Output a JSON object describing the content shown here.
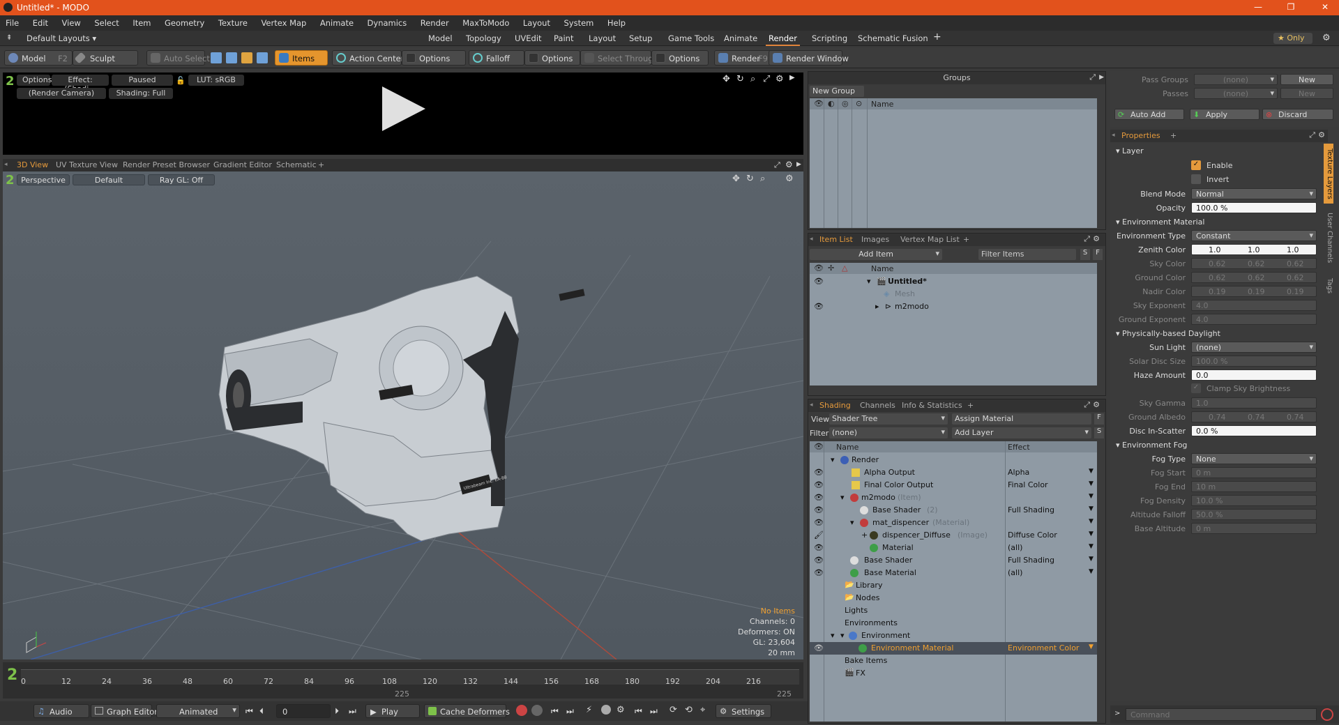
{
  "window": {
    "title": "Untitled* - MODO",
    "minimize": "—",
    "maximize": "❐",
    "close": "✕"
  },
  "menu": [
    "File",
    "Edit",
    "View",
    "Select",
    "Item",
    "Geometry",
    "Texture",
    "Vertex Map",
    "Animate",
    "Dynamics",
    "Render",
    "MaxToModo",
    "Layout",
    "System",
    "Help"
  ],
  "layouts": {
    "selector": "Default Layouts ▾",
    "tabs": [
      "Model",
      "Topology",
      "UVEdit",
      "Paint",
      "Layout",
      "Setup",
      "Game Tools",
      "Animate",
      "Render",
      "Scripting",
      "Schematic Fusion"
    ],
    "active": "Render",
    "add": "+",
    "only": "★ Only"
  },
  "toolbar": {
    "model": "Model",
    "model_key": "F2",
    "sculpt": "Sculpt",
    "auto_select": "Auto Select",
    "items": "Items",
    "action_center": "Action Center",
    "options1": "Options",
    "falloff": "Falloff",
    "options2": "Options",
    "select_through": "Select Through",
    "options3": "Options",
    "render": "Render",
    "render_key": "F9",
    "render_window": "Render Window"
  },
  "preview": {
    "options": "Options",
    "effect": "Effect: (Shadi...",
    "paused": "Paused",
    "lut": "LUT: sRGB",
    "camera": "(Render Camera)",
    "shading": "Shading: Full"
  },
  "viewtabs": {
    "tabs": [
      "3D View",
      "UV Texture View",
      "Render Preset Browser",
      "Gradient Editor",
      "Schematic"
    ],
    "add": "+"
  },
  "viewport": {
    "projection": "Perspective",
    "style": "Default",
    "raygl": "Ray GL: Off",
    "stats": [
      "No Items",
      "Channels: 0",
      "Deformers: ON",
      "GL: 23,604",
      "20 mm"
    ],
    "model_label": "Ultrabeam Inc. EA-88"
  },
  "timeline": {
    "ticks": [
      "0",
      "12",
      "24",
      "36",
      "48",
      "60",
      "72",
      "84",
      "96",
      "108",
      "120",
      "132",
      "144",
      "156",
      "168",
      "180",
      "192",
      "204",
      "216"
    ],
    "mid": "225",
    "end": "225"
  },
  "bottom": {
    "audio": "Audio",
    "graph_editor": "Graph Editor",
    "animated": "Animated",
    "frame": "0",
    "play": "Play",
    "cache": "Cache Deformers",
    "settings": "Settings"
  },
  "groups": {
    "title": "Groups",
    "new_group": "New Group",
    "col_name": "Name"
  },
  "itemlist": {
    "tabs": [
      "Item List",
      "Images",
      "Vertex Map List"
    ],
    "add": "+",
    "add_item": "Add Item",
    "filter": "Filter Items",
    "col_name": "Name",
    "rows": [
      {
        "name": "Untitled*"
      },
      {
        "name": "Mesh"
      },
      {
        "name": "m2modo"
      }
    ]
  },
  "shading": {
    "tabs": [
      "Shading",
      "Channels",
      "Info & Statistics"
    ],
    "add": "+",
    "view_label": "View",
    "view_value": "Shader Tree",
    "assign": "Assign Material",
    "filter_label": "Filter",
    "filter_value": "(none)",
    "add_layer": "Add Layer",
    "col_name": "Name",
    "col_effect": "Effect",
    "rows": [
      {
        "name": "Render",
        "sub": "",
        "effect": ""
      },
      {
        "name": "Alpha Output",
        "sub": "",
        "effect": "Alpha"
      },
      {
        "name": "Final Color Output",
        "sub": "",
        "effect": "Final Color"
      },
      {
        "name": "m2modo",
        "sub": "(Item)",
        "effect": ""
      },
      {
        "name": "Base Shader",
        "sub": "(2)",
        "effect": "Full Shading"
      },
      {
        "name": "mat_dispencer",
        "sub": "(Material)",
        "effect": ""
      },
      {
        "name": "dispencer_Diffuse",
        "sub": "(Image)",
        "effect": "Diffuse Color"
      },
      {
        "name": "Material",
        "sub": "",
        "effect": "(all)"
      },
      {
        "name": "Base Shader",
        "sub": "",
        "effect": "Full Shading"
      },
      {
        "name": "Base Material",
        "sub": "",
        "effect": "(all)"
      },
      {
        "name": "Library",
        "sub": "",
        "effect": ""
      },
      {
        "name": "Nodes",
        "sub": "",
        "effect": ""
      },
      {
        "name": "Lights",
        "sub": "",
        "effect": ""
      },
      {
        "name": "Environments",
        "sub": "",
        "effect": ""
      },
      {
        "name": "Environment",
        "sub": "",
        "effect": ""
      },
      {
        "name": "Environment Material",
        "sub": "",
        "effect": "Environment Color"
      },
      {
        "name": "Bake Items",
        "sub": "",
        "effect": ""
      },
      {
        "name": "FX",
        "sub": "",
        "effect": ""
      }
    ]
  },
  "pass": {
    "groups_label": "Pass Groups",
    "groups_value": "(none)",
    "passes_label": "Passes",
    "passes_value": "(none)",
    "new": "New",
    "new2": "New",
    "auto_add": "Auto Add",
    "apply": "Apply",
    "discard": "Discard"
  },
  "properties": {
    "tab": "Properties",
    "add": "+",
    "side_tabs": [
      "Texture Layers",
      "User Channels",
      "Tags"
    ],
    "layer": "Layer",
    "enable": "Enable",
    "invert": "Invert",
    "blend_label": "Blend Mode",
    "blend": "Normal",
    "opacity_label": "Opacity",
    "opacity": "100.0 %",
    "env_material": "Environment Material",
    "env_type_label": "Environment Type",
    "env_type": "Constant",
    "zenith_label": "Zenith Color",
    "zenith": [
      "1.0",
      "1.0",
      "1.0"
    ],
    "sky_label": "Sky Color",
    "sky": [
      "0.62",
      "0.62",
      "0.62"
    ],
    "ground_label": "Ground Color",
    "ground": [
      "0.62",
      "0.62",
      "0.62"
    ],
    "nadir_label": "Nadir Color",
    "nadir": [
      "0.19",
      "0.19",
      "0.19"
    ],
    "skyexp_label": "Sky Exponent",
    "skyexp": "4.0",
    "groundexp_label": "Ground Exponent",
    "groundexp": "4.0",
    "daylight": "Physically-based Daylight",
    "sun_label": "Sun Light",
    "sun": "(none)",
    "solar_label": "Solar Disc Size",
    "solar": "100.0 %",
    "haze_label": "Haze Amount",
    "haze": "0.0",
    "clamp": "Clamp Sky Brightness",
    "gamma_label": "Sky Gamma",
    "gamma": "1.0",
    "albedo_label": "Ground Albedo",
    "albedo": [
      "0.74",
      "0.74",
      "0.74"
    ],
    "disc_label": "Disc In-Scatter",
    "disc": "0.0 %",
    "fog": "Environment Fog",
    "fogtype_label": "Fog Type",
    "fogtype": "None",
    "fogstart_label": "Fog Start",
    "fogstart": "0 m",
    "fogend_label": "Fog End",
    "fogend": "10 m",
    "fogdens_label": "Fog Density",
    "fogdens": "10.0 %",
    "altfall_label": "Altitude Falloff",
    "altfall": "50.0 %",
    "basealt_label": "Base Altitude",
    "basealt": "0 m"
  },
  "command": {
    "placeholder": "Command"
  },
  "colors": {
    "accent": "#e59a3c",
    "title": "#e2521c",
    "selected": "#f0a030"
  }
}
